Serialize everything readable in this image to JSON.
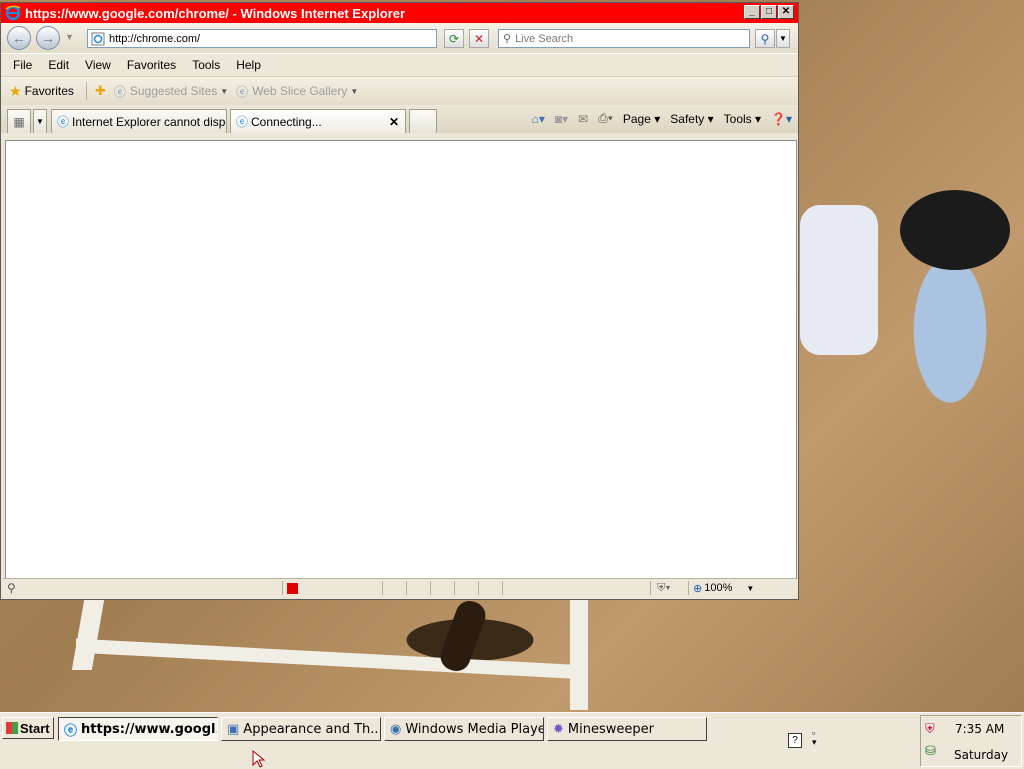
{
  "window": {
    "title": "https://www.google.com/chrome/ - Windows Internet Explorer",
    "controls": {
      "minimize": "_",
      "maximize": "□",
      "close": "✕"
    }
  },
  "nav": {
    "address": "http://chrome.com/",
    "search_placeholder": "Live Search"
  },
  "menu": [
    "File",
    "Edit",
    "View",
    "Favorites",
    "Tools",
    "Help"
  ],
  "favorites_bar": {
    "favorites_label": "Favorites",
    "suggested_sites": "Suggested Sites",
    "web_slice_gallery": "Web Slice Gallery"
  },
  "tabs": [
    {
      "label": "Internet Explorer cannot displ..."
    },
    {
      "label": "Connecting..."
    }
  ],
  "command_bar": {
    "page": "Page",
    "safety": "Safety",
    "tools": "Tools"
  },
  "status_bar": {
    "zoom": "100%"
  },
  "taskbar": {
    "start_label": "Start",
    "tasks": [
      {
        "label": "https://www.googl..."
      },
      {
        "label": "Appearance and Th..."
      },
      {
        "label": "Windows Media Player"
      },
      {
        "label": "Minesweeper"
      }
    ],
    "clock": {
      "time": "7:35 AM",
      "day": "Saturday"
    }
  },
  "colors": {
    "title_bar": "#ff0000",
    "stop_indicator": "#e00000"
  }
}
